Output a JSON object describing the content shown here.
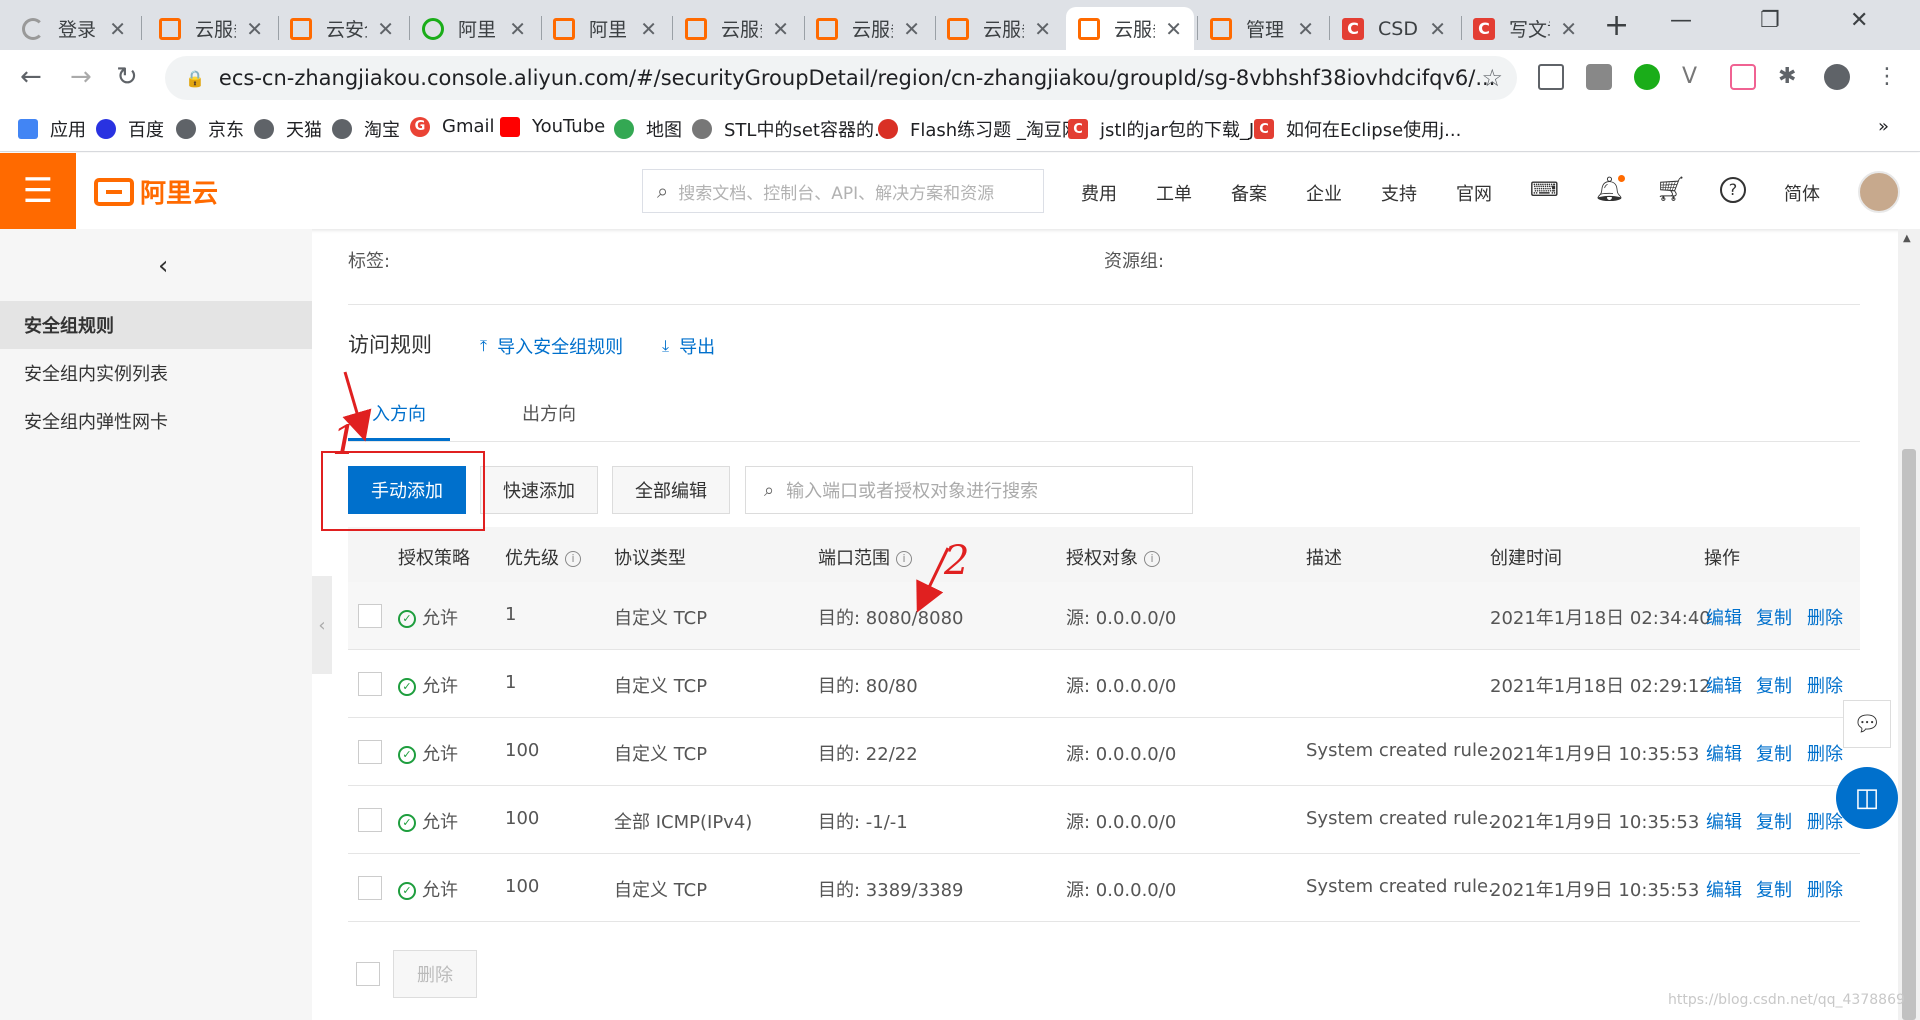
{
  "browser": {
    "tabs": [
      {
        "title": "登录",
        "icon": "spinner-icon"
      },
      {
        "title": "云服务器",
        "icon": "aliyun-icon"
      },
      {
        "title": "云安全",
        "icon": "aliyun-icon"
      },
      {
        "title": "阿里",
        "icon": "green-circle-icon"
      },
      {
        "title": "阿里",
        "icon": "aliyun-icon"
      },
      {
        "title": "云服务器",
        "icon": "aliyun-icon"
      },
      {
        "title": "云服务器",
        "icon": "aliyun-icon"
      },
      {
        "title": "云服务器",
        "icon": "aliyun-icon"
      },
      {
        "title": "云服务器",
        "icon": "aliyun-icon"
      },
      {
        "title": "管理",
        "icon": "aliyun-icon"
      },
      {
        "title": "CSDN",
        "icon": "csdn-icon"
      },
      {
        "title": "写文章",
        "icon": "csdn-icon"
      }
    ],
    "active_tab": 8,
    "close_glyph": "✕",
    "new_tab_glyph": "+",
    "url": "ecs-cn-zhangjiakou.console.aliyun.com/#/securityGroupDetail/region/cn-zhangjiakou/groupId/sg-8vbhshf38iovhdcifqv6/...",
    "bookmarks": [
      {
        "label": "应用",
        "icon": "apps-grid-icon"
      },
      {
        "label": "百度",
        "icon": "baidu-paw-icon"
      },
      {
        "label": "京东",
        "icon": "globe-icon"
      },
      {
        "label": "天猫",
        "icon": "globe-icon"
      },
      {
        "label": "淘宝",
        "icon": "globe-icon"
      },
      {
        "label": "Gmail",
        "icon": "google-g-icon"
      },
      {
        "label": "YouTube",
        "icon": "youtube-icon"
      },
      {
        "label": "地图",
        "icon": "maps-icon"
      },
      {
        "label": "STL中的set容器的...",
        "icon": "script-icon"
      },
      {
        "label": "Flash练习题 _淘豆网",
        "icon": "taodou-icon"
      },
      {
        "label": "jstl的jar包的下载_J...",
        "icon": "csdn-icon"
      },
      {
        "label": "如何在Eclipse使用j...",
        "icon": "csdn-icon"
      }
    ],
    "more_glyph": "»"
  },
  "console": {
    "logo_text": "阿里云",
    "search_placeholder": "搜索文档、控制台、API、解决方案和资源",
    "nav_links": [
      "费用",
      "工单",
      "备案",
      "企业",
      "支持",
      "官网"
    ],
    "lang": "简体"
  },
  "sidebar": {
    "collapse_glyph": "‹",
    "items": [
      {
        "label": "安全组规则",
        "active": true
      },
      {
        "label": "安全组内实例列表",
        "active": false
      },
      {
        "label": "安全组内弹性网卡",
        "active": false
      }
    ]
  },
  "detail": {
    "tags_label": "标签:",
    "resource_group_label": "资源组:"
  },
  "rules": {
    "title": "访问规则",
    "import_label": "导入安全组规则",
    "export_label": "导出",
    "tabs": [
      "入方向",
      "出方向"
    ],
    "active_tab": 0,
    "buttons": {
      "manual_add": "手动添加",
      "quick_add": "快速添加",
      "edit_all": "全部编辑"
    },
    "search_placeholder": "输入端口或者授权对象进行搜索",
    "columns": [
      "授权策略",
      "优先级",
      "协议类型",
      "端口范围",
      "授权对象",
      "描述",
      "创建时间",
      "操作"
    ],
    "rows": [
      {
        "policy": "允许",
        "priority": "1",
        "protocol": "自定义 TCP",
        "port": "目的: 8080/8080",
        "source": "源: 0.0.0.0/0",
        "desc": "",
        "created": "2021年1月18日 02:34:40"
      },
      {
        "policy": "允许",
        "priority": "1",
        "protocol": "自定义 TCP",
        "port": "目的: 80/80",
        "source": "源: 0.0.0.0/0",
        "desc": "",
        "created": "2021年1月18日 02:29:12"
      },
      {
        "policy": "允许",
        "priority": "100",
        "protocol": "自定义 TCP",
        "port": "目的: 22/22",
        "source": "源: 0.0.0.0/0",
        "desc": "System created rule.",
        "created": "2021年1月9日 10:35:53"
      },
      {
        "policy": "允许",
        "priority": "100",
        "protocol": "全部 ICMP(IPv4)",
        "port": "目的: -1/-1",
        "source": "源: 0.0.0.0/0",
        "desc": "System created rule.",
        "created": "2021年1月9日 10:35:53"
      },
      {
        "policy": "允许",
        "priority": "100",
        "protocol": "自定义 TCP",
        "port": "目的: 3389/3389",
        "source": "源: 0.0.0.0/0",
        "desc": "System created rule.",
        "created": "2021年1月9日 10:35:53"
      }
    ],
    "row_actions": [
      "编辑",
      "复制",
      "删除"
    ],
    "bulk_delete": "删除"
  },
  "annotations": {
    "step1": "1",
    "step2": "2",
    "color": "#e02020"
  },
  "watermark": "https://blog.csdn.net/qq_4378869",
  "colors": {
    "brand": "#ff6a00",
    "primary": "#0070cc",
    "allow": "#1e9e3e"
  }
}
